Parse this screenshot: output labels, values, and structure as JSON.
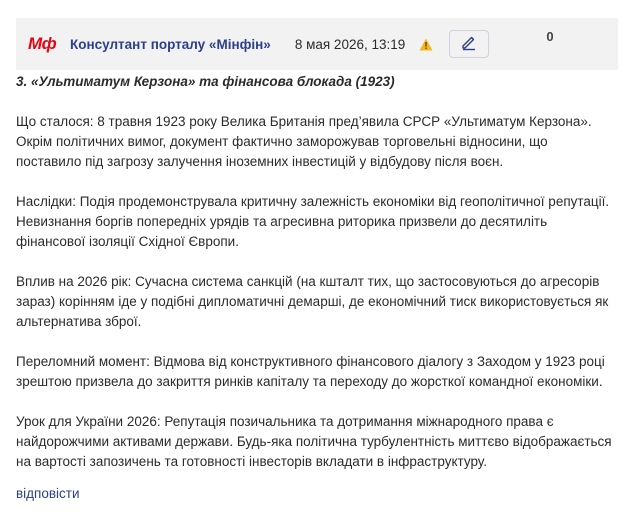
{
  "header": {
    "logo": "Мф",
    "author": "Консултант порталу «Мінфін»",
    "datetime": "8 мая 2026, 13:19",
    "count": "0"
  },
  "icons": {
    "warning": "warning-triangle-icon",
    "edit": "pencil-icon"
  },
  "content": {
    "heading": "3. «Ультиматум Керзона» та фінансова блокада (1923)",
    "paragraphs": [
      "Що сталося: 8 травня 1923 року Велика Британія пред’явила СРСР «Ультиматум Керзона». Окрім політичних вимог, документ фактично заморожував торговельні відносини, що поставило під загрозу залучення іноземних інвестицій у відбудову після воєн.",
      "Наслідки: Подія продемонструвала критичну залежність економіки від геополітичної репутації. Невизнання боргів попередніх урядів та агресивна риторика призвели до десятиліть фінансової ізоляції Східної Європи.",
      "Вплив на 2026 рік: Сучасна система санкцій (на кшталт тих, що застосовуються до агресорів зараз) корінням іде у подібні дипломатичні демарші, де економічний тиск використовується як альтернатива зброї.",
      "Переломний момент: Відмова від конструктивного фінансового діалогу з Заходом у 1923 році зрештою призвела до закриття ринків капіталу та переходу до жорсткої командної економіки.",
      "Урок для України 2026: Репутація позичальника та дотримання міжнародного права є найдорожчими активами держави. Будь-яка політична турбулентність миттєво відображається на вартості запозичень та готовності інвесторів вкладати в інфраструктуру."
    ]
  },
  "footer": {
    "reply": "відповісти"
  }
}
